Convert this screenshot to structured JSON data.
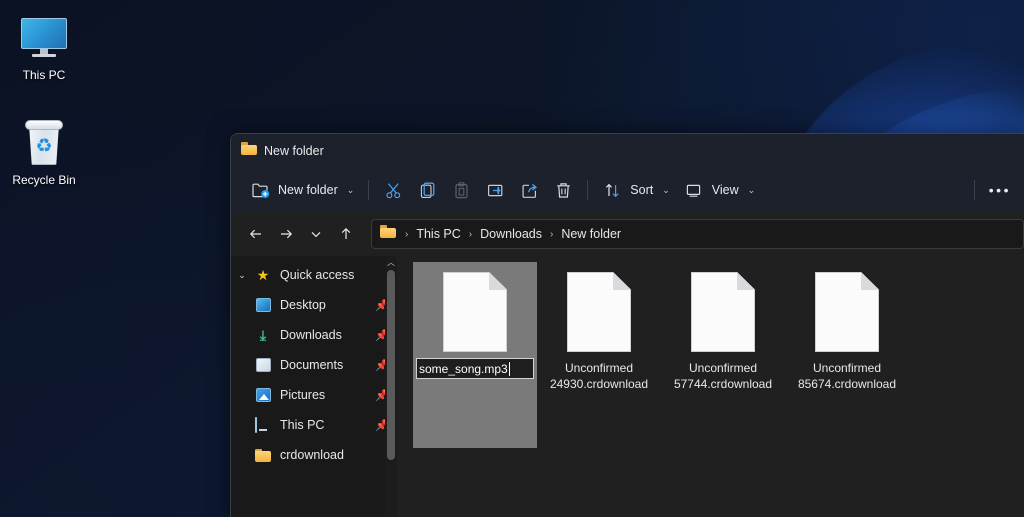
{
  "desktop": {
    "icons": [
      {
        "name": "This PC",
        "icon": "monitor-icon"
      },
      {
        "name": "Recycle Bin",
        "icon": "recycle-bin-icon"
      }
    ]
  },
  "window": {
    "title": "New folder",
    "title_icon": "folder-icon"
  },
  "toolbar": {
    "new_folder_label": "New folder",
    "new_folder_icon": "new-folder-icon",
    "dropdown_chevron": "⌄",
    "actions": [
      {
        "name": "cut",
        "icon": "scissors-icon",
        "enabled": true
      },
      {
        "name": "copy",
        "icon": "copy-icon",
        "enabled": true
      },
      {
        "name": "paste",
        "icon": "paste-icon",
        "enabled": false
      },
      {
        "name": "rename",
        "icon": "rename-icon",
        "enabled": true
      },
      {
        "name": "share",
        "icon": "share-icon",
        "enabled": true
      },
      {
        "name": "delete",
        "icon": "trash-icon",
        "enabled": true
      }
    ],
    "sort_label": "Sort",
    "sort_icon": "sort-arrows-icon",
    "view_label": "View",
    "view_icon": "view-monitor-icon",
    "more_label": "•••"
  },
  "address": {
    "back_icon": "arrow-left-icon",
    "forward_icon": "arrow-right-icon",
    "recent_icon": "chevron-down-icon",
    "up_icon": "arrow-up-icon",
    "crumb_icon": "folder-icon",
    "separator": "›",
    "crumbs": [
      "This PC",
      "Downloads",
      "New folder"
    ]
  },
  "sidebar": {
    "items": [
      {
        "label": "Quick access",
        "icon": "star-icon",
        "expander": "⌄",
        "pinned": false,
        "child": false
      },
      {
        "label": "Desktop",
        "icon": "desktop-icon",
        "pinned": true,
        "child": true
      },
      {
        "label": "Downloads",
        "icon": "downloads-icon",
        "pinned": true,
        "child": true
      },
      {
        "label": "Documents",
        "icon": "documents-icon",
        "pinned": true,
        "child": true
      },
      {
        "label": "Pictures",
        "icon": "pictures-icon",
        "pinned": true,
        "child": true
      },
      {
        "label": "This PC",
        "icon": "this-pc-icon",
        "pinned": true,
        "child": true
      },
      {
        "label": "crdownload",
        "icon": "folder-icon",
        "pinned": false,
        "child": true
      }
    ],
    "pin_glyph": "📌",
    "scroll_up_glyph": "︿"
  },
  "files": [
    {
      "name": "some_song.mp3",
      "icon": "generic-file-icon",
      "selected": true,
      "renaming": true
    },
    {
      "name": "Unconfirmed 24930.crdownload",
      "icon": "generic-file-icon",
      "selected": false,
      "renaming": false
    },
    {
      "name": "Unconfirmed 57744.crdownload",
      "icon": "generic-file-icon",
      "selected": false,
      "renaming": false
    },
    {
      "name": "Unconfirmed 85674.crdownload",
      "icon": "generic-file-icon",
      "selected": false,
      "renaming": false
    }
  ],
  "colors": {
    "accent_blue": "#4aa3f0",
    "titlebar_bg": "#1d212b",
    "content_bg": "#202020",
    "sidebar_bg": "#191919",
    "selection_bg": "#7a7a7a",
    "folder_yellow": "#f3b23f",
    "text_primary": "#e8e8e8"
  }
}
